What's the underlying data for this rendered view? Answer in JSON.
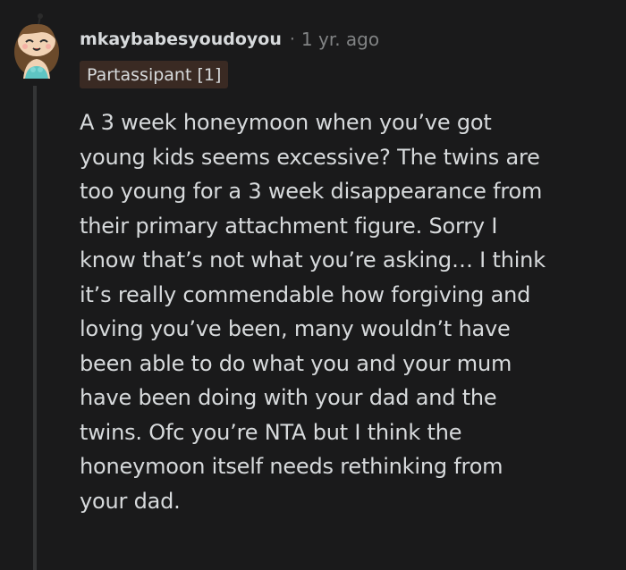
{
  "comment": {
    "author": "mkaybabesyoudoyou",
    "separator": "·",
    "timestamp": "1 yr. ago",
    "flair": "Partassipant [1]",
    "avatar_icon": "snoo-avatar-icon",
    "body_lines": [
      "A 3 week honeymoon when you’ve got",
      "young kids seems excessive? The twins are",
      "too young for a 3 week disappearance from",
      "their primary attachment figure. Sorry I",
      "know that’s not what you’re asking… I think",
      "it’s really commendable how forgiving and",
      "loving you’ve been, many wouldn’t have",
      "been able to do what you and your mum",
      "have been doing with your dad and the",
      "twins. Ofc you’re NTA but I think the",
      "honeymoon itself needs rethinking from",
      "your dad."
    ]
  },
  "colors": {
    "background": "#1a1a1b",
    "text": "#d7dadc",
    "meta": "#818384",
    "flair_bg": "#3a2a23",
    "thread_line": "#343536"
  }
}
